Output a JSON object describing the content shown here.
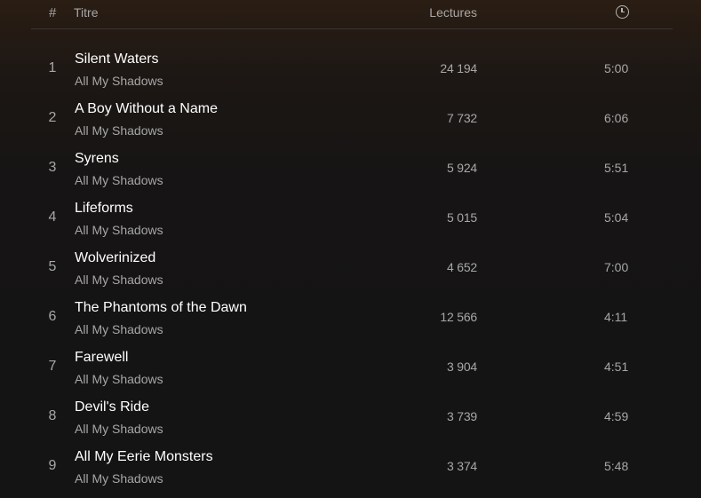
{
  "header": {
    "num": "#",
    "title": "Titre",
    "plays": "Lectures",
    "duration_icon": "clock-icon"
  },
  "tracks": [
    {
      "num": "1",
      "title": "Silent Waters",
      "artist": "All My Shadows",
      "plays": "24 194",
      "duration": "5:00"
    },
    {
      "num": "2",
      "title": "A Boy Without a Name",
      "artist": "All My Shadows",
      "plays": "7 732",
      "duration": "6:06"
    },
    {
      "num": "3",
      "title": "Syrens",
      "artist": "All My Shadows",
      "plays": "5 924",
      "duration": "5:51"
    },
    {
      "num": "4",
      "title": "Lifeforms",
      "artist": "All My Shadows",
      "plays": "5 015",
      "duration": "5:04"
    },
    {
      "num": "5",
      "title": "Wolverinized",
      "artist": "All My Shadows",
      "plays": "4 652",
      "duration": "7:00"
    },
    {
      "num": "6",
      "title": "The Phantoms of the Dawn",
      "artist": "All My Shadows",
      "plays": "12 566",
      "duration": "4:11"
    },
    {
      "num": "7",
      "title": "Farewell",
      "artist": "All My Shadows",
      "plays": "3 904",
      "duration": "4:51"
    },
    {
      "num": "8",
      "title": "Devil's Ride",
      "artist": "All My Shadows",
      "plays": "3 739",
      "duration": "4:59"
    },
    {
      "num": "9",
      "title": "All My Eerie Monsters",
      "artist": "All My Shadows",
      "plays": "3 374",
      "duration": "5:48"
    }
  ]
}
